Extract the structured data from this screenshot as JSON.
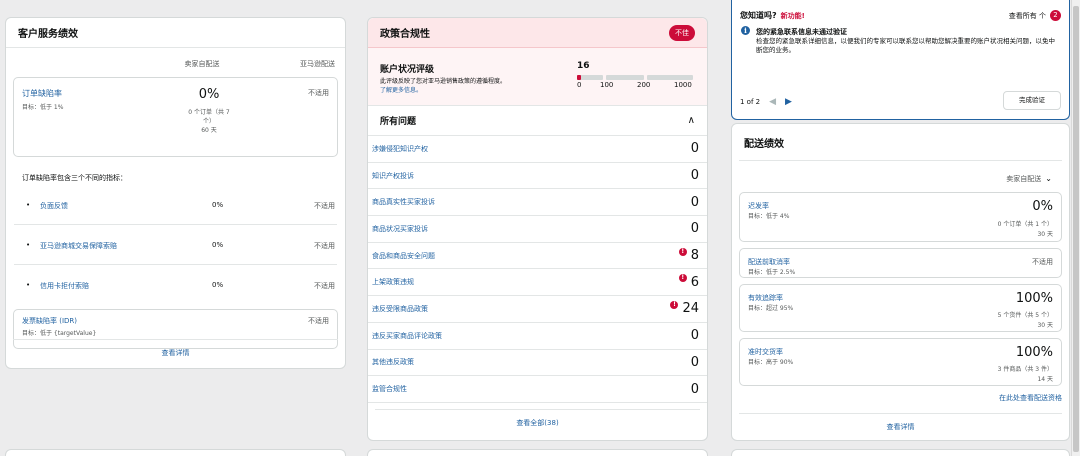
{
  "customer_service": {
    "title": "客户服务绩效",
    "col_seller": "卖家自配送",
    "col_amazon": "亚马逊配送",
    "odr": {
      "name": "订单缺陷率",
      "target": "目标：低于 1%",
      "value": "0%",
      "orders_line1": "0 个订单（共 7",
      "orders_line2": "个）",
      "period": "60 天",
      "amazon": "不适用"
    },
    "note": "订单缺陷率包含三个不同的指标：",
    "sub_metrics": [
      {
        "bullet": "•",
        "name": "负面反馈",
        "pct": "0%",
        "amazon": "不适用"
      },
      {
        "bullet": "•",
        "name": "亚马逊商城交易保障索赔",
        "pct": "0%",
        "amazon": "不适用"
      },
      {
        "bullet": "•",
        "name": "信用卡拒付索赔",
        "pct": "0%",
        "amazon": "不适用"
      }
    ],
    "idr": {
      "name": "发票缺陷率 (IDR)",
      "target": "目标：低于 {targetValue}",
      "amazon": "不适用"
    },
    "view_details": "查看详情"
  },
  "policy": {
    "title": "政策合规性",
    "badge": "不佳",
    "ahr_title": "账户状况评级",
    "ahr_desc": "此评级反映了您对亚马逊销售政策的遵循程度。",
    "ahr_link": "了解更多信息。",
    "ahr_score": "16",
    "ahr_score_value": 16,
    "ahr_max": 1000,
    "ahr_ticks": [
      "0",
      "100",
      "200",
      "1000"
    ],
    "issues_title": "所有问题",
    "collapse_glyph": "∧",
    "issues": [
      {
        "name": "涉嫌侵犯知识产权",
        "count": "0",
        "alert": ""
      },
      {
        "name": "知识产权投诉",
        "count": "0",
        "alert": ""
      },
      {
        "name": "商品真实性买家投诉",
        "count": "0",
        "alert": ""
      },
      {
        "name": "商品状况买家投诉",
        "count": "0",
        "alert": ""
      },
      {
        "name": "食品和商品安全问题",
        "count": "8",
        "alert": "!"
      },
      {
        "name": "上架政策违规",
        "count": "6",
        "alert": "!"
      },
      {
        "name": "违反受限商品政策",
        "count": "24",
        "alert": "!"
      },
      {
        "name": "违反买家商品评论政策",
        "count": "0",
        "alert": ""
      },
      {
        "name": "其他违反政策",
        "count": "0",
        "alert": ""
      },
      {
        "name": "监管合规性",
        "count": "0",
        "alert": ""
      }
    ],
    "view_all": "查看全部(38)"
  },
  "did_you_know": {
    "title": "您知道吗?",
    "new_label": "新功能!",
    "view_all": "查看所有 个",
    "count": "2",
    "info_glyph": "i",
    "msg_title": "您的紧急联系信息未通过验证",
    "msg_desc": "检查您的紧急联系详细信息，以便我们的专家可以联系您以帮助您解决重要的账户状况相关问题，以免中断您的业务。",
    "pager": "1 of 2",
    "prev_glyph": "◀",
    "next_glyph": "▶",
    "verify_button": "完成验证"
  },
  "delivery": {
    "title": "配送绩效",
    "selector": "卖家自配送",
    "selector_glyph": "⌄",
    "metrics": [
      {
        "name": "迟发率",
        "target": "目标：低于 4%",
        "value": "0%",
        "detail": "0 个订单（共 1 个）",
        "period": "30 天"
      },
      {
        "name": "配送前取消率",
        "target": "目标：低于 2.5%",
        "na": "不适用"
      },
      {
        "name": "有效追踪率",
        "target": "目标：超过 95%",
        "value": "100%",
        "detail": "5 个货件（共 5 个）",
        "period": "30 天"
      },
      {
        "name": "准时交货率",
        "target": "目标：高于 90%",
        "value": "100%",
        "detail": "3 件商品（共 3 件）",
        "period": "14 天"
      }
    ],
    "eligibility_link": "在此处查看配送资格",
    "view_details": "查看详情"
  },
  "colors": {
    "link": "#2162a1",
    "alert": "#cc0c39",
    "policy_bg": "#fde7e9",
    "info_border": "#2162a1"
  }
}
